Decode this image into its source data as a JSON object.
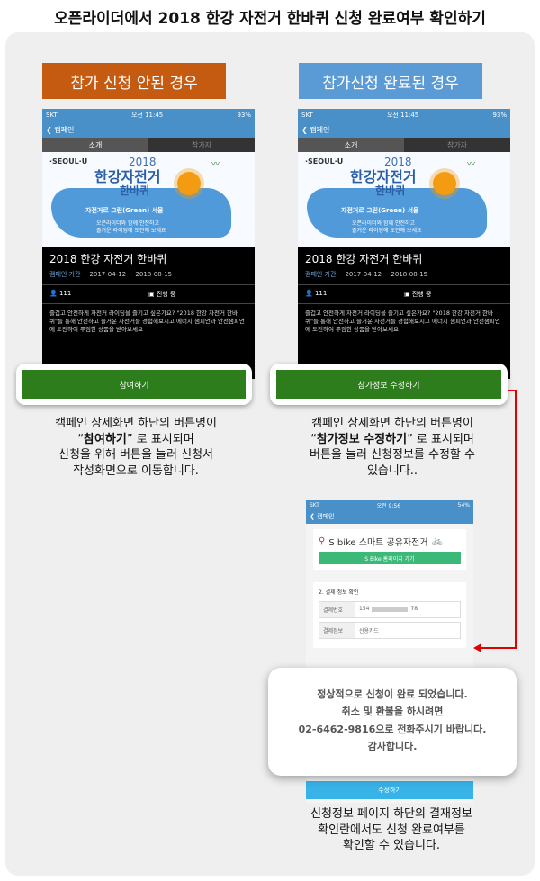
{
  "page_title": "오픈라이더에서 2018 한강 자전거 한바퀴 신청 완료여부 확인하기",
  "left": {
    "header": "참가 신청 안된 경우",
    "button": "참여하기",
    "caption_line1": "캠페인 상세화면 하단의 버튼명이",
    "caption_bold": "참여하기",
    "caption_line2_rest": "” 로 표시되며",
    "caption_line3": "신청을 위해 버튼을 눌러 신청서",
    "caption_line4": "작성화면으로 이동합니다."
  },
  "right": {
    "header": "참가신청 완료된 경우",
    "button": "참가정보 수정하기",
    "caption_line1": "캠페인 상세화면 하단의 버튼명이",
    "caption_bold": "참가정보 수정하기",
    "caption_line2_rest": "” 로 표시되며",
    "caption_line3": "버튼을 눌러 신청정보를 수정할 수",
    "caption_line4": "있습니다.."
  },
  "phone": {
    "carrier": "SKT",
    "time": "오전 11:45",
    "battery": "93%",
    "back": "캠페인",
    "tab_intro": "소개",
    "tab_participants": "참가자",
    "logo": "·SEOUL·U",
    "banner_year": "2018",
    "banner_title": "한강자전거",
    "banner_title2": "한바퀴",
    "banner_slogan": "자전거로 그린(Green) 서울",
    "banner_sub1": "오픈라이더와 함께 안전하고",
    "banner_sub2": "즐거운 라이딩에 도전해 보세요",
    "event_title": "2018 한강 자전거 한바퀴",
    "period_label": "캠페인 기간",
    "period": "2017-04-12 ~ 2018-08-15",
    "participants": "111",
    "status": "진행 중",
    "desc": "즐겁고 안전하게 자전거 라이딩을 즐기고 싶은가요? \"2018 한강 자전거 한바퀴\"를 통해 안전하고 즐거운 자전거를 경험해보시고 에너지 챔피언과 안전챔피언에 도전하여 푸짐한 상품을 받아보세요"
  },
  "phone2": {
    "carrier": "SKT",
    "time": "오전 9:56",
    "battery": "54%",
    "back": "캠페인",
    "sbike_label": "S bike 스마트 공유자전거",
    "sbike_button": "S Bike 홈페이지 가기",
    "section": "2. 결제 정보 확인",
    "pay_no_label": "결제번호",
    "pay_no_value": "154",
    "pay_no_suffix": "78",
    "pay_info_label": "결제정보",
    "pay_info_value": "신용카드",
    "bottom_button": "수정하기"
  },
  "popup": {
    "line1": "정상적으로 신청이 완료 되었습니다.",
    "line2": "취소 및 환불을 하시려면",
    "line3": "02-6462-9816으로 전화주시기 바랍니다.",
    "line4": "감사합니다."
  },
  "bottom_caption": {
    "line1": "신청정보 페이지 하단의 결재정보",
    "line2": "확인란에서도 신청 완료여부를",
    "line3": "확인할 수 있습니다."
  },
  "colors": {
    "orange": "#c55a11",
    "blue": "#5b9bd5",
    "green": "#2e7d1c",
    "arrow": "#e00000"
  }
}
